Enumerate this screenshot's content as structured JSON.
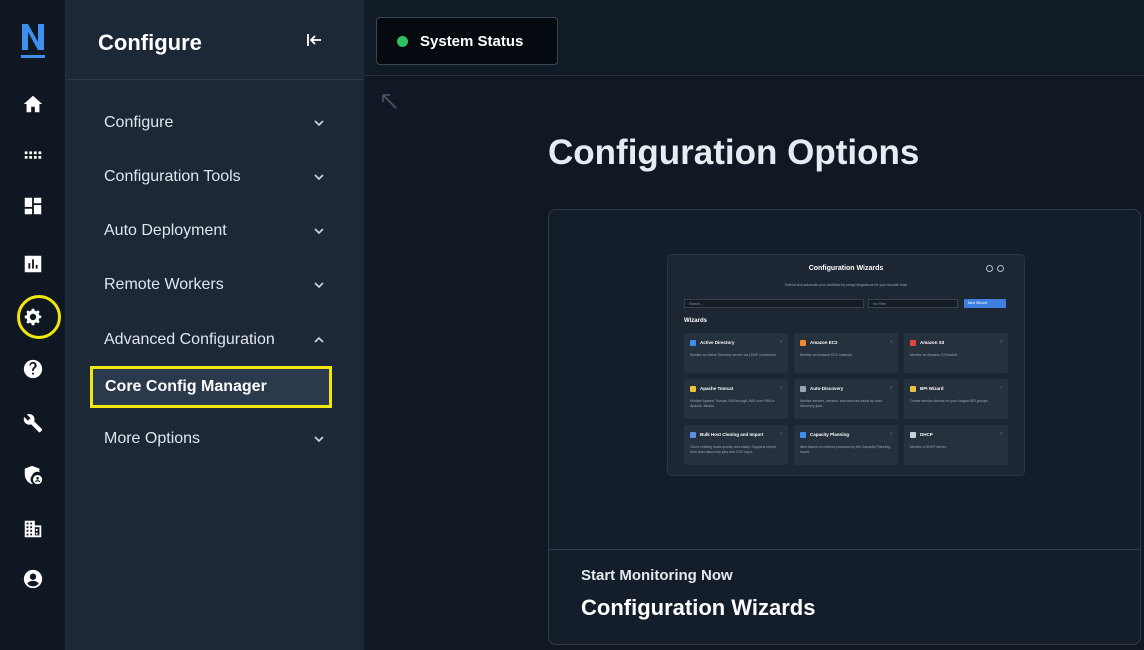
{
  "rail": {
    "items": [
      {
        "icon": "home-icon"
      },
      {
        "icon": "grid-icon"
      },
      {
        "icon": "dashboard-icon"
      },
      {
        "icon": "reports-icon"
      },
      {
        "icon": "gear-icon"
      },
      {
        "icon": "help-icon"
      },
      {
        "icon": "wrench-icon"
      },
      {
        "icon": "shield-user-icon"
      },
      {
        "icon": "building-icon"
      },
      {
        "icon": "user-account-icon"
      }
    ]
  },
  "sidebar": {
    "title": "Configure",
    "items": [
      {
        "label": "Configure",
        "chevron": "down"
      },
      {
        "label": "Configuration Tools",
        "chevron": "down"
      },
      {
        "label": "Auto Deployment",
        "chevron": "down"
      },
      {
        "label": "Remote Workers",
        "chevron": "down"
      },
      {
        "label": "Advanced Configuration",
        "chevron": "up"
      },
      {
        "label": "More Options",
        "chevron": "down"
      }
    ],
    "subitem": {
      "label": "Core Config Manager"
    }
  },
  "topbar": {
    "status_tab": {
      "label": "System Status",
      "dot_color": "#2ec162"
    }
  },
  "main": {
    "title": "Configuration Options",
    "card": {
      "subtitle": "Start Monitoring Now",
      "title": "Configuration Wizards"
    }
  },
  "preview": {
    "title": "Configuration Wizards",
    "subtitle": "Extend and automate your workflow by using integrations for your favorite tools",
    "search_placeholder": "Search...",
    "filter_label": "No Filter",
    "new_button": "New Wizard",
    "section": "Wizards",
    "cards": [
      {
        "name": "Active Directory",
        "desc": "Monitor an Active Directory server via LDAP connection.",
        "color": "#3d8ff0"
      },
      {
        "name": "Amazon EC2",
        "desc": "Monitor an Amazon EC2 Instance.",
        "color": "#f08a24"
      },
      {
        "name": "Amazon S3",
        "desc": "Monitor an Amazon S3 Bucket.",
        "color": "#e0463a"
      },
      {
        "name": "Apache Tomcat",
        "desc": "Monitor Apache Tomcat JVM through JMX over RMI or Apache Jolokia.",
        "color": "#f2c230"
      },
      {
        "name": "Auto-Discovery",
        "desc": "Monitor servers, devices, and services found by auto-discovery jobs.",
        "color": "#9aa6b3"
      },
      {
        "name": "BPI Wizard",
        "desc": "Create service checks for your Nagios BPI groups.",
        "color": "#e8c43a"
      },
      {
        "name": "Bulk Host Cloning and Import",
        "desc": "Clone existing hosts quickly and easily. Supports import from auto-discovery jobs and CSV input.",
        "color": "#5c8de6"
      },
      {
        "name": "Capacity Planning",
        "desc": "Alert based on metrics produced by the Capacity Planning report.",
        "color": "#3d8ff0"
      },
      {
        "name": "DHCP",
        "desc": "Monitor a DHCP server.",
        "color": "#c9d2dc"
      }
    ]
  }
}
